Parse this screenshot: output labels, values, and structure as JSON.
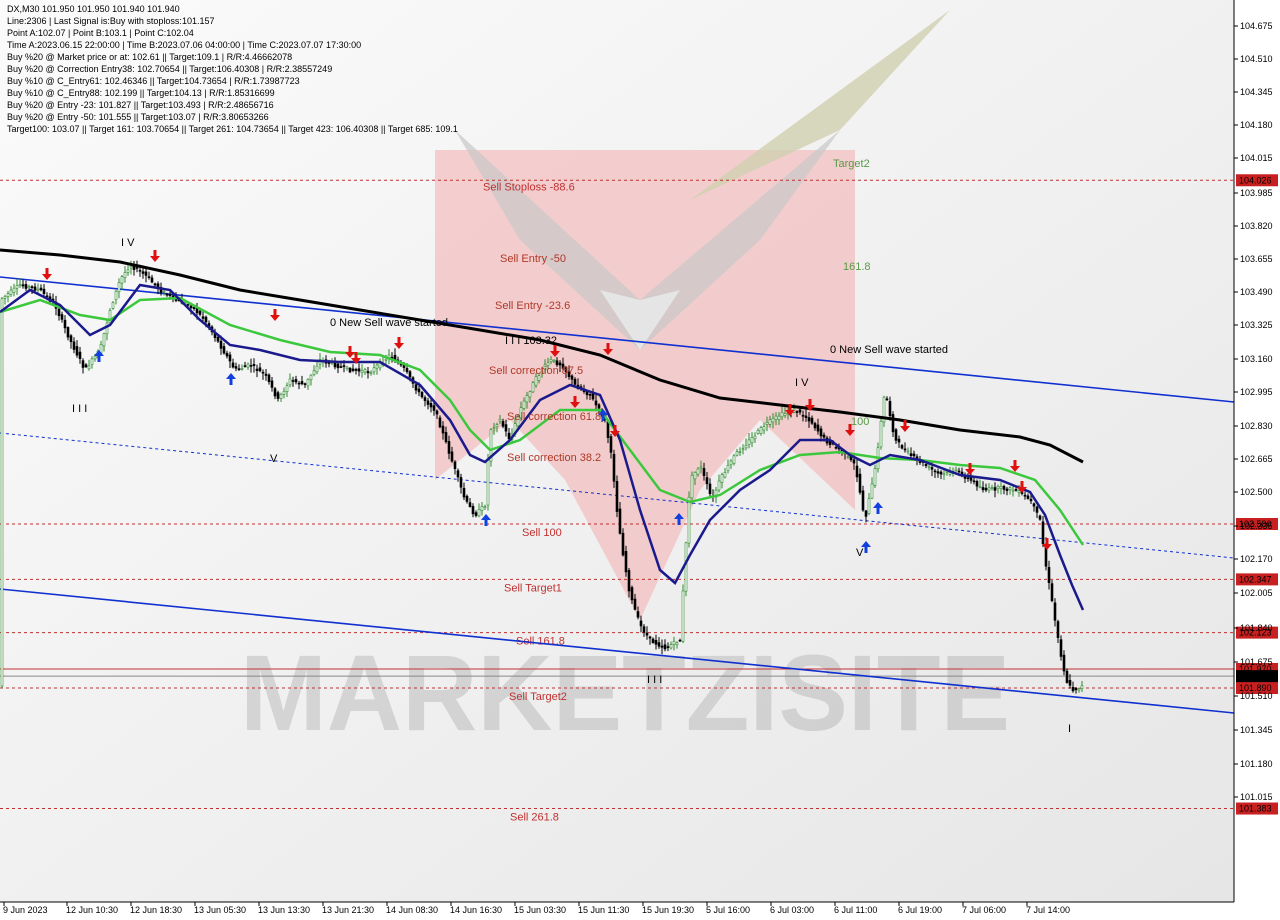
{
  "info": {
    "lines": [
      "DX,M30  101.950 101.950 101.940 101.940",
      "Line:2306  | Last Signal is:Buy with stoploss:101.157",
      "Point A:102.07  | Point B:103.1  | Point C:102.04",
      "Time A:2023.06.15 22:00:00  | Time B:2023.07.06 04:00:00  | Time C:2023.07.07 17:30:00",
      "Buy %20 @ Market price or at: 102.61  || Target:109.1  | R/R:4.46662078",
      "Buy %20 @ Correction Entry38: 102.70654  || Target:106.40308  | R/R:2.38557249",
      "Buy %10 @ C_Entry61: 102.46346  || Target:104.73654  | R/R:1.73987723",
      "Buy %10 @ C_Entry88: 102.199  || Target:104.13  | R/R:1.85316699",
      "Buy %20 @ Entry -23: 101.827  || Target:103.493  | R/R:2.48656716",
      "Buy %20 @ Entry -50: 101.555  || Target:103.07  | R/R:3.80653266",
      "Target100: 103.07  || Target 161: 103.70654  || Target 261: 104.73654  || Target 423: 106.40308  || Target 685: 109.1"
    ]
  },
  "chart_data": {
    "type": "candlestick",
    "symbol": "DX",
    "timeframe": "M30",
    "ylim": [
      101.08,
      104.86
    ],
    "y_ticks": [
      "104.675",
      "104.510",
      "104.345",
      "104.180",
      "104.015",
      "103.985",
      "103.820",
      "103.655",
      "103.490",
      "103.325",
      "103.160",
      "102.995",
      "102.830",
      "102.665",
      "102.500",
      "102.335",
      "102.170",
      "102.005",
      "101.840",
      "101.675",
      "101.510",
      "101.345",
      "101.180",
      "101.015"
    ],
    "x_labels": [
      "9 Jun 2023",
      "12 Jun 10:30",
      "12 Jun 18:30",
      "13 Jun 05:30",
      "13 Jun 13:30",
      "13 Jun 21:30",
      "14 Jun 08:30",
      "14 Jun 16:30",
      "15 Jun 03:30",
      "15 Jun 11:30",
      "15 Jun 19:30",
      "5 Jul 16:00",
      "6 Jul 03:00",
      "6 Jul 11:00",
      "6 Jul 19:00",
      "7 Jul 06:00",
      "7 Jul 14:00"
    ],
    "price_levels": [
      {
        "price": 104.026,
        "label": "Sell Stoploss -88.6",
        "tag": "104.026",
        "color": "#c03030"
      },
      {
        "price": 102.58,
        "label": "Sell 100",
        "tag": "102.580",
        "color": "#c03030"
      },
      {
        "price": 102.347,
        "label": "Sell Target1",
        "tag": "102.347",
        "color": "#c03030"
      },
      {
        "price": 102.123,
        "label": "Sell 161.8",
        "tag": "102.123",
        "color": "#c03030"
      },
      {
        "price": 101.97,
        "label": "",
        "tag": "101.970",
        "color": "#c03030"
      },
      {
        "price": 101.89,
        "label": "Sell Target2",
        "tag": "101.890",
        "color": "#c03030"
      },
      {
        "price": 101.383,
        "label": "Sell  261.8",
        "tag": "101.383",
        "color": "#c03030"
      }
    ],
    "current_price": {
      "price": 101.94,
      "tag": "101.940"
    },
    "chart_labels": [
      {
        "text": "Target2",
        "color": "#5a9a48"
      },
      {
        "text": "161.8",
        "color": "#5a9a48"
      },
      {
        "text": "Sell Entry -50",
        "color": "#b03828"
      },
      {
        "text": "Sell Entry -23.6",
        "color": "#b03828"
      },
      {
        "text": "0 New Sell wave started",
        "color": "#000000"
      },
      {
        "text": "0 New Sell wave started",
        "color": "#000000"
      },
      {
        "text": "Sell correction 87.5",
        "color": "#b03828"
      },
      {
        "text": "Sell correction 61.8",
        "color": "#b03828"
      },
      {
        "text": "Sell correction 38.2",
        "color": "#b03828"
      },
      {
        "text": "I I I  103.32",
        "color": "#000000"
      },
      {
        "text": "I V",
        "color": "#000000"
      },
      {
        "text": "I I I",
        "color": "#000000"
      },
      {
        "text": "V",
        "color": "#000000"
      },
      {
        "text": "I V",
        "color": "#000000"
      },
      {
        "text": "100",
        "color": "#5a9a48"
      },
      {
        "text": "V",
        "color": "#000000"
      },
      {
        "text": "I I I",
        "color": "#000000"
      },
      {
        "text": "I",
        "color": "#000000"
      }
    ],
    "watermark": "MARKETZISITE",
    "colors": {
      "bull_candle": "#2e8b2e",
      "bear_candle": "#000000",
      "ma_black": "#000000",
      "ma_navy": "#1a1a8c",
      "ma_green": "#3cc83c",
      "channel": "#1030d0",
      "level": "#c03030",
      "background": "#ffffff",
      "tag_bg": "#c82020",
      "current_tag_bg": "#000000"
    }
  }
}
